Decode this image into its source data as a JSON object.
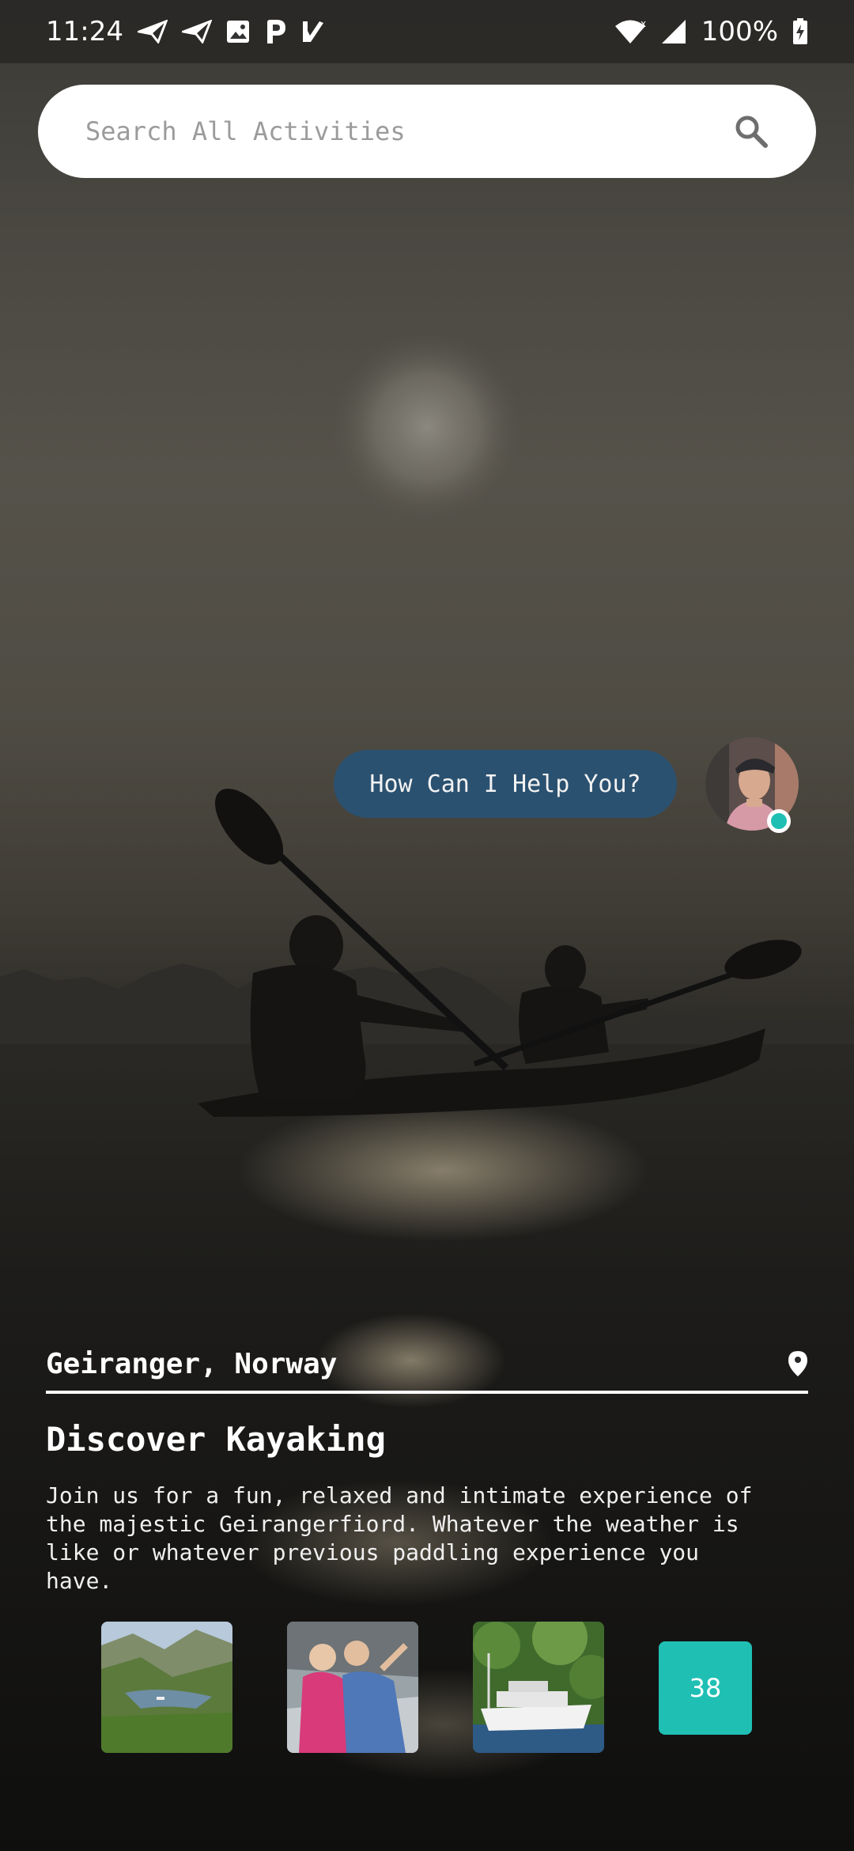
{
  "status_bar": {
    "time": "11:24",
    "left_icons": [
      "send-icon",
      "send-icon",
      "image-icon",
      "parking-icon",
      "flag-check-icon"
    ],
    "battery": "100%",
    "right_icons": [
      "wifi-icon",
      "signal-icon",
      "battery-charging-icon"
    ]
  },
  "search": {
    "placeholder": "Search All Activities",
    "value": ""
  },
  "assistant": {
    "bubble_text": "How Can I Help You?",
    "online_color": "#1fbfb4"
  },
  "activity": {
    "location": "Geiranger, Norway",
    "title": "Discover Kayaking",
    "description": "Join us for a fun, relaxed and intimate experience of the majestic Geirangerfiord. Whatever the weather is like or whatever previous paddling experience you have.",
    "thumbnails": [
      "fjord-valley-photo",
      "couple-on-boat-photo",
      "ferry-boat-photo"
    ],
    "more_count": "38"
  },
  "colors": {
    "accent": "#1fbfb4",
    "bubble": "#2b5170"
  }
}
